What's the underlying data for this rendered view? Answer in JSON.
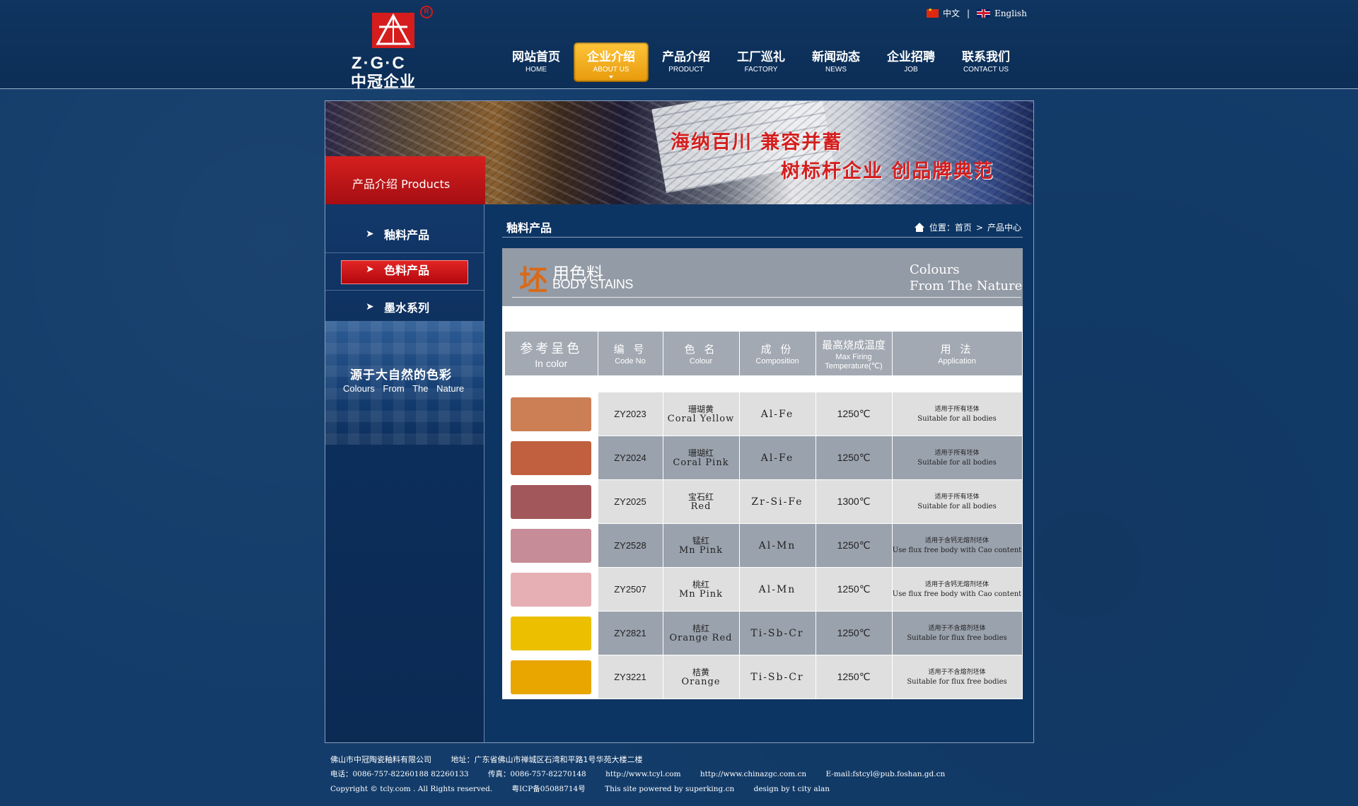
{
  "header": {
    "logo": {
      "brand_en": "Z·G·C",
      "brand_zh": "中冠企业",
      "registered": "R"
    },
    "lang": {
      "cn": "中文",
      "separator": "|",
      "en": "English"
    },
    "nav": [
      {
        "zh": "网站首页",
        "en": "HOME"
      },
      {
        "zh": "企业介绍",
        "en": "ABOUT US"
      },
      {
        "zh": "产品介绍",
        "en": "PRODUCT"
      },
      {
        "zh": "工厂巡礼",
        "en": "FACTORY"
      },
      {
        "zh": "新闻动态",
        "en": "NEWS"
      },
      {
        "zh": "企业招聘",
        "en": "JOB"
      },
      {
        "zh": "联系我们",
        "en": "CONTACT US"
      }
    ],
    "active_nav": "企业介绍"
  },
  "banner": {
    "slogan1": "海纳百川  兼容并蓄",
    "slogan2": "树标杆企业  创品牌典范",
    "section_tag": "产品介绍 Products"
  },
  "sidebar": {
    "items": [
      {
        "label": "釉料产品"
      },
      {
        "label": "色料产品"
      },
      {
        "label": "墨水系列"
      }
    ],
    "active_item": "色料产品",
    "tagline_zh": "源于大自然的色彩",
    "tagline_en": "Colours From The Nature"
  },
  "content": {
    "title": "釉料产品",
    "breadcrumb": {
      "prefix": "位置：",
      "home": "首页",
      "separator": ">",
      "current": "产品中心"
    },
    "panel": {
      "big_char": "坯",
      "title_cn": "用色料",
      "title_en": "BODY STAINS",
      "right1": "Colours",
      "right2": "From The Nature"
    },
    "table": {
      "headers": [
        {
          "zh": "参考呈色",
          "en": "In color"
        },
        {
          "zh": "编 号",
          "en": "Code No"
        },
        {
          "zh": "色 名",
          "en": "Colour"
        },
        {
          "zh": "成 份",
          "en": "Composition"
        },
        {
          "zh": "最高烧成温度",
          "en": "Max Firing Temperature(℃)"
        },
        {
          "zh": "用 法",
          "en": "Application"
        }
      ],
      "rows": [
        {
          "color": "#cc7e54",
          "code": "ZY2023",
          "name_zh": "珊瑚黄",
          "name_en": "Coral Yellow",
          "comp": "Al-Fe",
          "temp": "1250℃",
          "use_zh": "适用于所有坯体",
          "use_en": "Suitable for all bodies"
        },
        {
          "color": "#c0603e",
          "code": "ZY2024",
          "name_zh": "珊瑚红",
          "name_en": "Coral Pink",
          "comp": "Al-Fe",
          "temp": "1250℃",
          "use_zh": "适用于所有坯体",
          "use_en": "Suitable for all bodies"
        },
        {
          "color": "#a2585b",
          "code": "ZY2025",
          "name_zh": "宝石红",
          "name_en": "Red",
          "comp": "Zr-Si-Fe",
          "temp": "1300℃",
          "use_zh": "适用于所有坯体",
          "use_en": "Suitable for all bodies"
        },
        {
          "color": "#c68c97",
          "code": "ZY2528",
          "name_zh": "锰红",
          "name_en": "Mn Pink",
          "comp": "Al-Mn",
          "temp": "1250℃",
          "use_zh": "适用于含钙无熔剂坯体",
          "use_en": "Use flux free body with Cao content"
        },
        {
          "color": "#e6afb3",
          "code": "ZY2507",
          "name_zh": "桃红",
          "name_en": "Mn Pink",
          "comp": "Al-Mn",
          "temp": "1250℃",
          "use_zh": "适用于含钙无熔剂坯体",
          "use_en": "Use flux free body with Cao content"
        },
        {
          "color": "#ecc000",
          "code": "ZY2821",
          "name_zh": "桔红",
          "name_en": "Orange Red",
          "comp": "Ti-Sb-Cr",
          "temp": "1250℃",
          "use_zh": "适用于不含熔剂坯体",
          "use_en": "Suitable for flux free bodies"
        },
        {
          "color": "#e9a600",
          "code": "ZY3221",
          "name_zh": "桔黄",
          "name_en": "Orange",
          "comp": "Ti-Sb-Cr",
          "temp": "1250℃",
          "use_zh": "适用于不含熔剂坯体",
          "use_en": "Suitable for flux free bodies"
        }
      ]
    }
  },
  "footer": {
    "company": "佛山市中冠陶瓷釉料有限公司",
    "address": "地址：广东省佛山市禅城区石湾和平路1号华苑大楼二楼",
    "phone": "电话：0086-757-82260188 82260133",
    "fax": "传真：0086-757-82270148",
    "site1": "http://www.tcyl.com",
    "site2": "http://www.chinazgc.com.cn",
    "email": "E-mail:fstcyl@pub.foshan.gd.cn",
    "copyright": "Copyright © tcly.com . All Rights reserved.",
    "icp": "粤ICP备05088714号",
    "powered": "This site powered by superking.cn",
    "design": "design by t city alan"
  }
}
